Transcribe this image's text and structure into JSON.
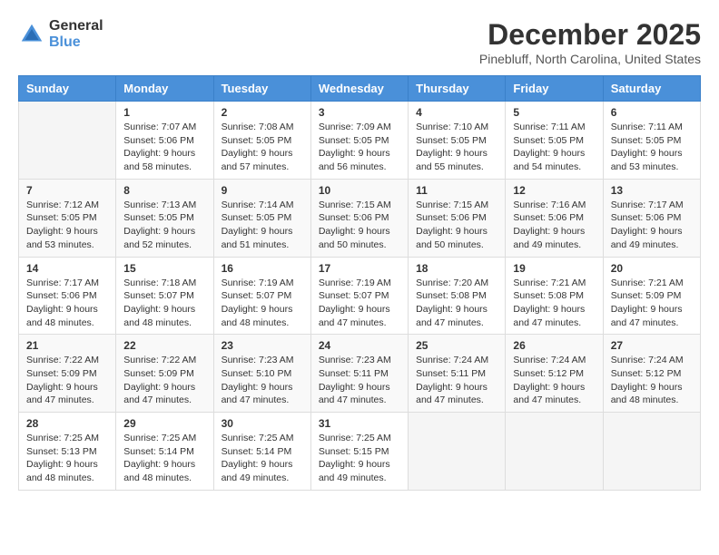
{
  "header": {
    "logo_general": "General",
    "logo_blue": "Blue",
    "month_title": "December 2025",
    "location": "Pinebluff, North Carolina, United States"
  },
  "columns": [
    "Sunday",
    "Monday",
    "Tuesday",
    "Wednesday",
    "Thursday",
    "Friday",
    "Saturday"
  ],
  "weeks": [
    [
      {
        "day": "",
        "info": ""
      },
      {
        "day": "1",
        "info": "Sunrise: 7:07 AM\nSunset: 5:06 PM\nDaylight: 9 hours\nand 58 minutes."
      },
      {
        "day": "2",
        "info": "Sunrise: 7:08 AM\nSunset: 5:05 PM\nDaylight: 9 hours\nand 57 minutes."
      },
      {
        "day": "3",
        "info": "Sunrise: 7:09 AM\nSunset: 5:05 PM\nDaylight: 9 hours\nand 56 minutes."
      },
      {
        "day": "4",
        "info": "Sunrise: 7:10 AM\nSunset: 5:05 PM\nDaylight: 9 hours\nand 55 minutes."
      },
      {
        "day": "5",
        "info": "Sunrise: 7:11 AM\nSunset: 5:05 PM\nDaylight: 9 hours\nand 54 minutes."
      },
      {
        "day": "6",
        "info": "Sunrise: 7:11 AM\nSunset: 5:05 PM\nDaylight: 9 hours\nand 53 minutes."
      }
    ],
    [
      {
        "day": "7",
        "info": "Sunrise: 7:12 AM\nSunset: 5:05 PM\nDaylight: 9 hours\nand 53 minutes."
      },
      {
        "day": "8",
        "info": "Sunrise: 7:13 AM\nSunset: 5:05 PM\nDaylight: 9 hours\nand 52 minutes."
      },
      {
        "day": "9",
        "info": "Sunrise: 7:14 AM\nSunset: 5:05 PM\nDaylight: 9 hours\nand 51 minutes."
      },
      {
        "day": "10",
        "info": "Sunrise: 7:15 AM\nSunset: 5:06 PM\nDaylight: 9 hours\nand 50 minutes."
      },
      {
        "day": "11",
        "info": "Sunrise: 7:15 AM\nSunset: 5:06 PM\nDaylight: 9 hours\nand 50 minutes."
      },
      {
        "day": "12",
        "info": "Sunrise: 7:16 AM\nSunset: 5:06 PM\nDaylight: 9 hours\nand 49 minutes."
      },
      {
        "day": "13",
        "info": "Sunrise: 7:17 AM\nSunset: 5:06 PM\nDaylight: 9 hours\nand 49 minutes."
      }
    ],
    [
      {
        "day": "14",
        "info": "Sunrise: 7:17 AM\nSunset: 5:06 PM\nDaylight: 9 hours\nand 48 minutes."
      },
      {
        "day": "15",
        "info": "Sunrise: 7:18 AM\nSunset: 5:07 PM\nDaylight: 9 hours\nand 48 minutes."
      },
      {
        "day": "16",
        "info": "Sunrise: 7:19 AM\nSunset: 5:07 PM\nDaylight: 9 hours\nand 48 minutes."
      },
      {
        "day": "17",
        "info": "Sunrise: 7:19 AM\nSunset: 5:07 PM\nDaylight: 9 hours\nand 47 minutes."
      },
      {
        "day": "18",
        "info": "Sunrise: 7:20 AM\nSunset: 5:08 PM\nDaylight: 9 hours\nand 47 minutes."
      },
      {
        "day": "19",
        "info": "Sunrise: 7:21 AM\nSunset: 5:08 PM\nDaylight: 9 hours\nand 47 minutes."
      },
      {
        "day": "20",
        "info": "Sunrise: 7:21 AM\nSunset: 5:09 PM\nDaylight: 9 hours\nand 47 minutes."
      }
    ],
    [
      {
        "day": "21",
        "info": "Sunrise: 7:22 AM\nSunset: 5:09 PM\nDaylight: 9 hours\nand 47 minutes."
      },
      {
        "day": "22",
        "info": "Sunrise: 7:22 AM\nSunset: 5:09 PM\nDaylight: 9 hours\nand 47 minutes."
      },
      {
        "day": "23",
        "info": "Sunrise: 7:23 AM\nSunset: 5:10 PM\nDaylight: 9 hours\nand 47 minutes."
      },
      {
        "day": "24",
        "info": "Sunrise: 7:23 AM\nSunset: 5:11 PM\nDaylight: 9 hours\nand 47 minutes."
      },
      {
        "day": "25",
        "info": "Sunrise: 7:24 AM\nSunset: 5:11 PM\nDaylight: 9 hours\nand 47 minutes."
      },
      {
        "day": "26",
        "info": "Sunrise: 7:24 AM\nSunset: 5:12 PM\nDaylight: 9 hours\nand 47 minutes."
      },
      {
        "day": "27",
        "info": "Sunrise: 7:24 AM\nSunset: 5:12 PM\nDaylight: 9 hours\nand 48 minutes."
      }
    ],
    [
      {
        "day": "28",
        "info": "Sunrise: 7:25 AM\nSunset: 5:13 PM\nDaylight: 9 hours\nand 48 minutes."
      },
      {
        "day": "29",
        "info": "Sunrise: 7:25 AM\nSunset: 5:14 PM\nDaylight: 9 hours\nand 48 minutes."
      },
      {
        "day": "30",
        "info": "Sunrise: 7:25 AM\nSunset: 5:14 PM\nDaylight: 9 hours\nand 49 minutes."
      },
      {
        "day": "31",
        "info": "Sunrise: 7:25 AM\nSunset: 5:15 PM\nDaylight: 9 hours\nand 49 minutes."
      },
      {
        "day": "",
        "info": ""
      },
      {
        "day": "",
        "info": ""
      },
      {
        "day": "",
        "info": ""
      }
    ]
  ]
}
